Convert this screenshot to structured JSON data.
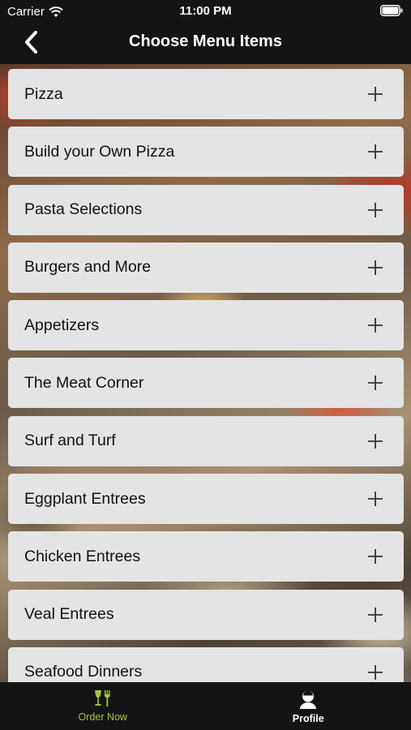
{
  "status_bar": {
    "carrier": "Carrier",
    "time": "11:00 PM"
  },
  "nav": {
    "title": "Choose Menu Items",
    "back_icon": "chevron-left-icon"
  },
  "menu": {
    "items": [
      {
        "label": "Pizza"
      },
      {
        "label": "Build your Own Pizza"
      },
      {
        "label": "Pasta Selections"
      },
      {
        "label": "Burgers and More"
      },
      {
        "label": "Appetizers"
      },
      {
        "label": "The Meat Corner"
      },
      {
        "label": "Surf and Turf"
      },
      {
        "label": "Eggplant Entrees"
      },
      {
        "label": "Chicken Entrees"
      },
      {
        "label": "Veal Entrees"
      },
      {
        "label": "Seafood Dinners"
      }
    ],
    "expand_icon": "plus-icon"
  },
  "tabbar": {
    "tabs": [
      {
        "label": "Order Now",
        "icon": "fork-knife-icon",
        "active": true
      },
      {
        "label": "Profile",
        "icon": "person-icon",
        "active": false
      }
    ]
  },
  "colors": {
    "accent": "#a4c639",
    "bar_background": "#141414",
    "item_background": "#e4e4e4"
  }
}
